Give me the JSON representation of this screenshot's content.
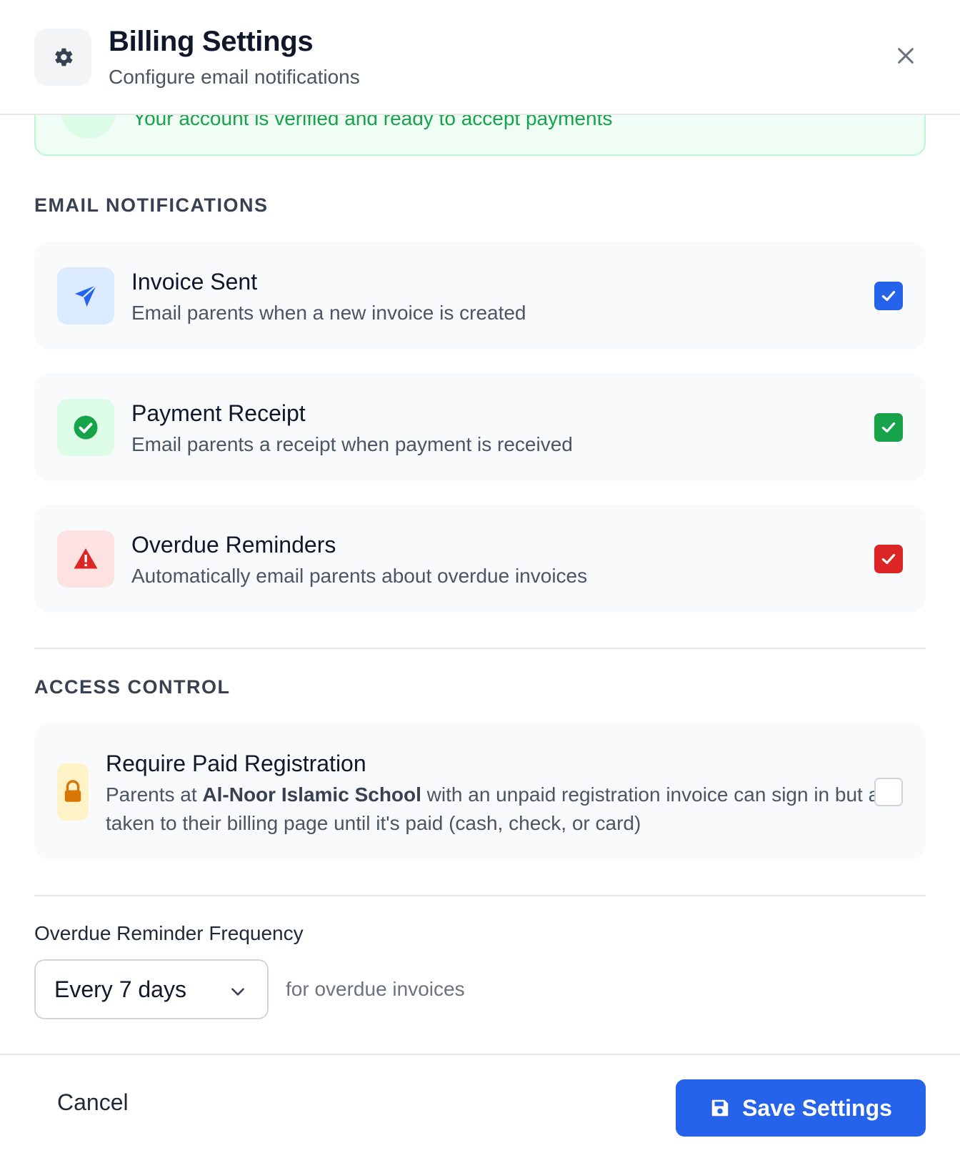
{
  "header": {
    "title": "Billing Settings",
    "subtitle": "Configure email notifications",
    "icon": "gear-icon",
    "close_icon": "close-icon"
  },
  "banner": {
    "text": "Your account is verified and ready to accept payments"
  },
  "email_notifications": {
    "section_title": "EMAIL NOTIFICATIONS",
    "items": [
      {
        "title": "Invoice Sent",
        "description": "Email parents when a new invoice is created",
        "icon": "paper-plane-icon",
        "checked": true,
        "accent": "#2563eb"
      },
      {
        "title": "Payment Receipt",
        "description": "Email parents a receipt when payment is received",
        "icon": "check-circle-icon",
        "checked": true,
        "accent": "#16a34a"
      },
      {
        "title": "Overdue Reminders",
        "description": "Automatically email parents about overdue invoices",
        "icon": "warning-icon",
        "checked": true,
        "accent": "#dc2626"
      }
    ]
  },
  "access_control": {
    "section_title": "ACCESS CONTROL",
    "title": "Require Paid Registration",
    "desc_prefix": "Parents at ",
    "school_name": "Al-Noor Islamic School",
    "desc_suffix": " with an unpaid registration invoice can sign in but are taken to their billing page until it's paid (cash, check, or card)",
    "icon": "lock-icon",
    "checked": false
  },
  "frequency": {
    "label": "Overdue Reminder Frequency",
    "selected": "Every 7 days",
    "suffix": "for overdue invoices"
  },
  "footer": {
    "cancel_label": "Cancel",
    "save_label": "Save Settings",
    "save_icon": "floppy-disk-icon"
  }
}
